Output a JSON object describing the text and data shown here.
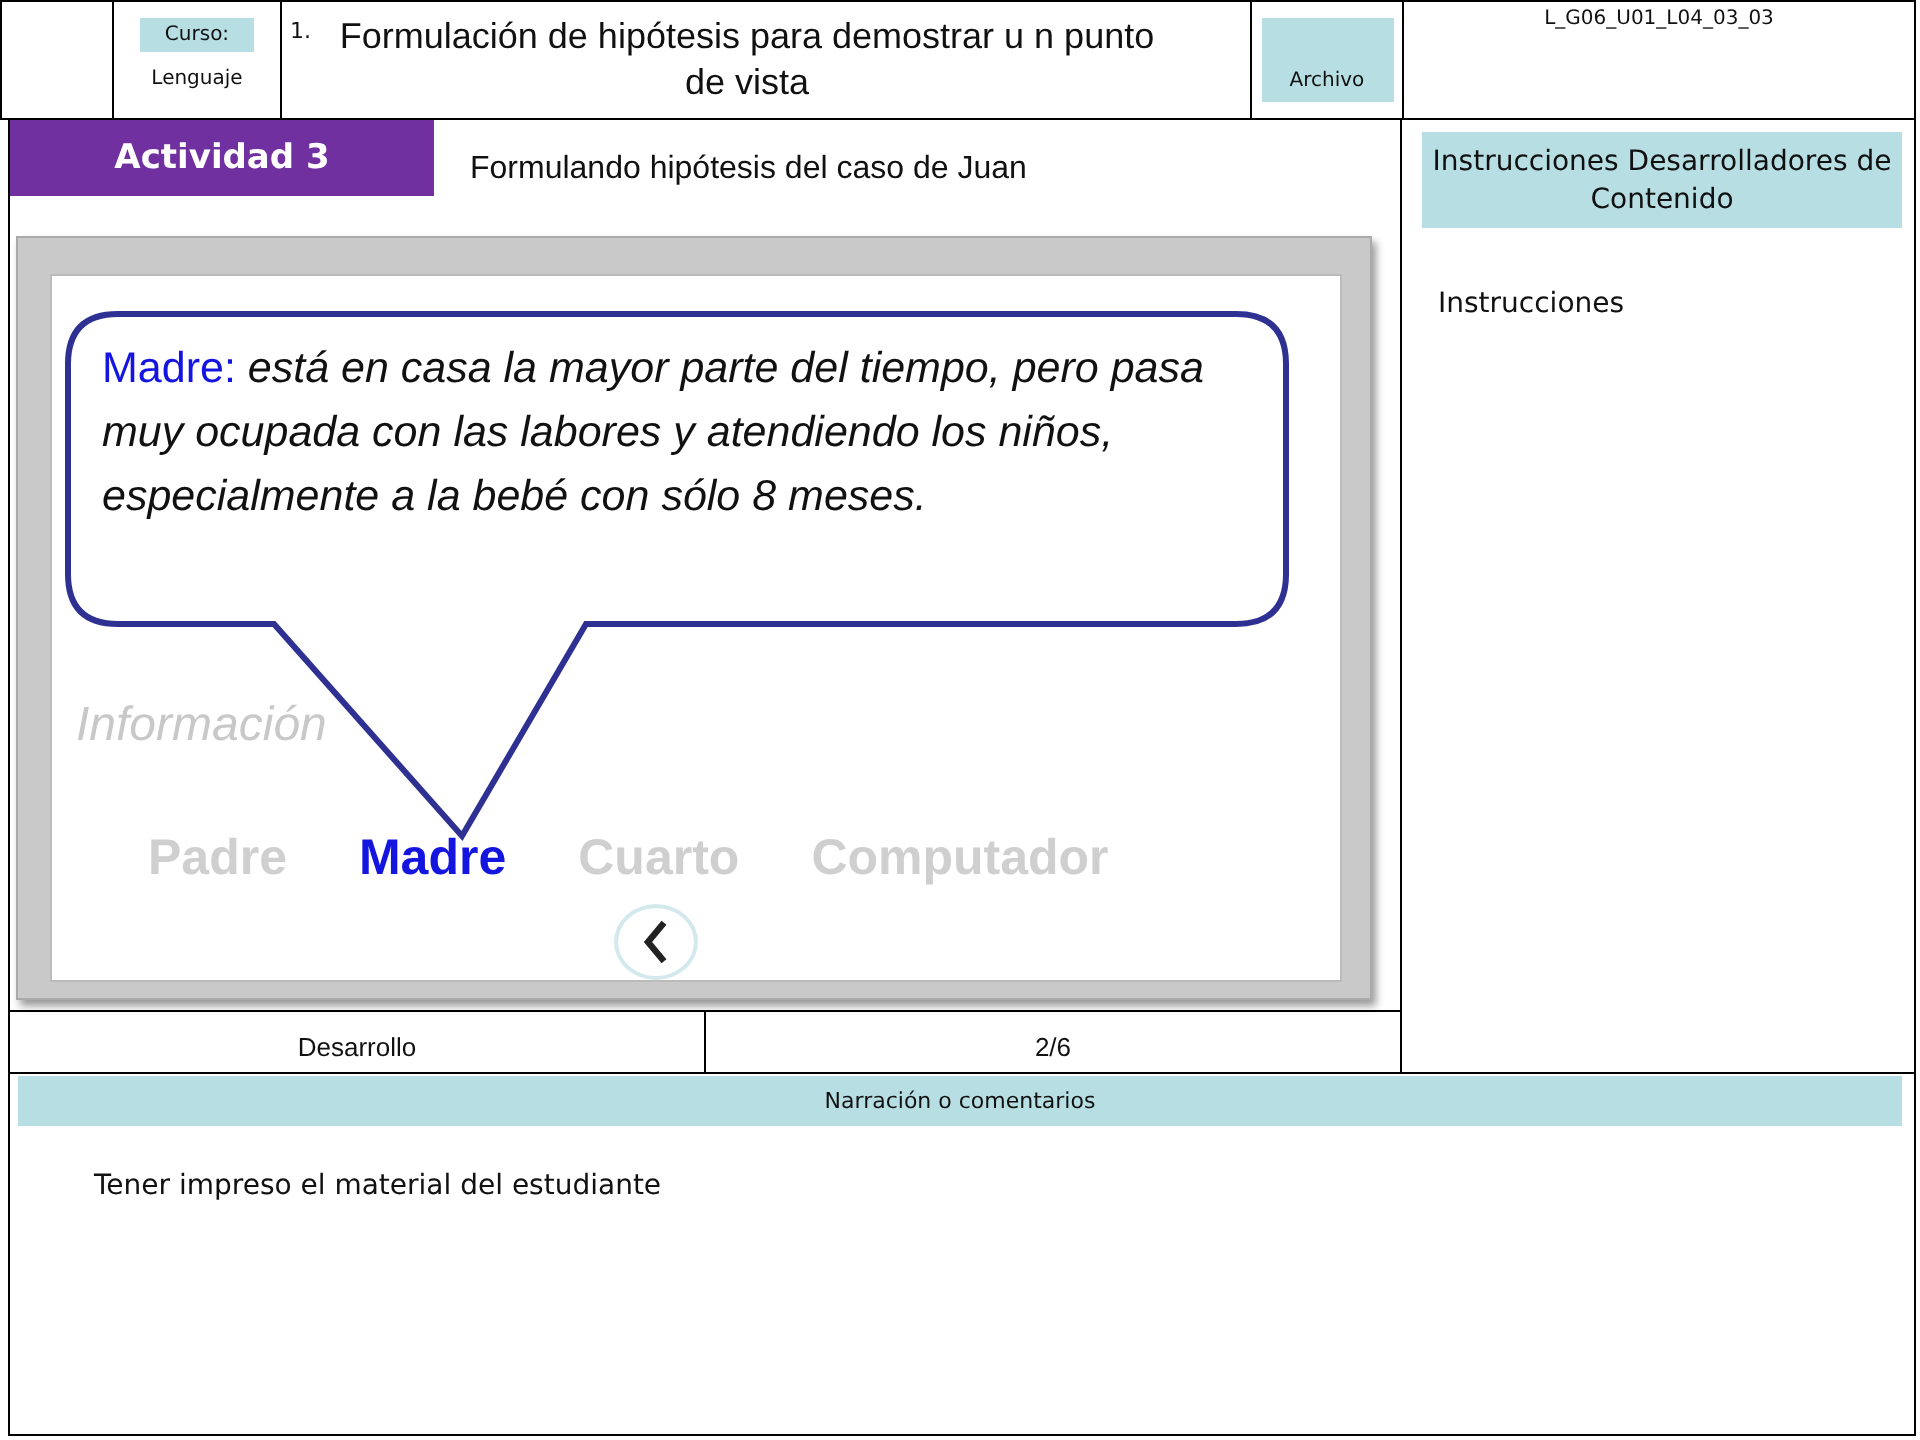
{
  "header": {
    "course_label": "Curso:",
    "course": "Lenguaje",
    "number": "1.",
    "title": "Formulación de hipótesis para demostrar u n punto de vista",
    "file_label": "Archivo",
    "code": "L_G06_U01_L04_03_03"
  },
  "activity": {
    "tab": "Actividad 3",
    "subtitle": "Formulando hipótesis del caso de Juan"
  },
  "mockup": {
    "callout": {
      "label": "Madre:",
      "text": "está en casa la mayor parte del tiempo, pero pasa muy ocupada con las labores y atendiendo los niños, especialmente a la bebé con sólo 8 meses."
    },
    "heading": "Información",
    "items": [
      {
        "label": "Padre",
        "selected": false
      },
      {
        "label": "Madre",
        "selected": true
      },
      {
        "label": "Cuarto",
        "selected": false
      },
      {
        "label": "Computador",
        "selected": false
      }
    ]
  },
  "footer_cells": [
    "Desarrollo",
    "2/6"
  ],
  "instructions": {
    "title": "Instrucciones Desarrolladores de Contenido",
    "text": "Instrucciones"
  },
  "narration": {
    "title": "Narración o comentarios",
    "text": "Tener impreso el material del estudiante"
  }
}
